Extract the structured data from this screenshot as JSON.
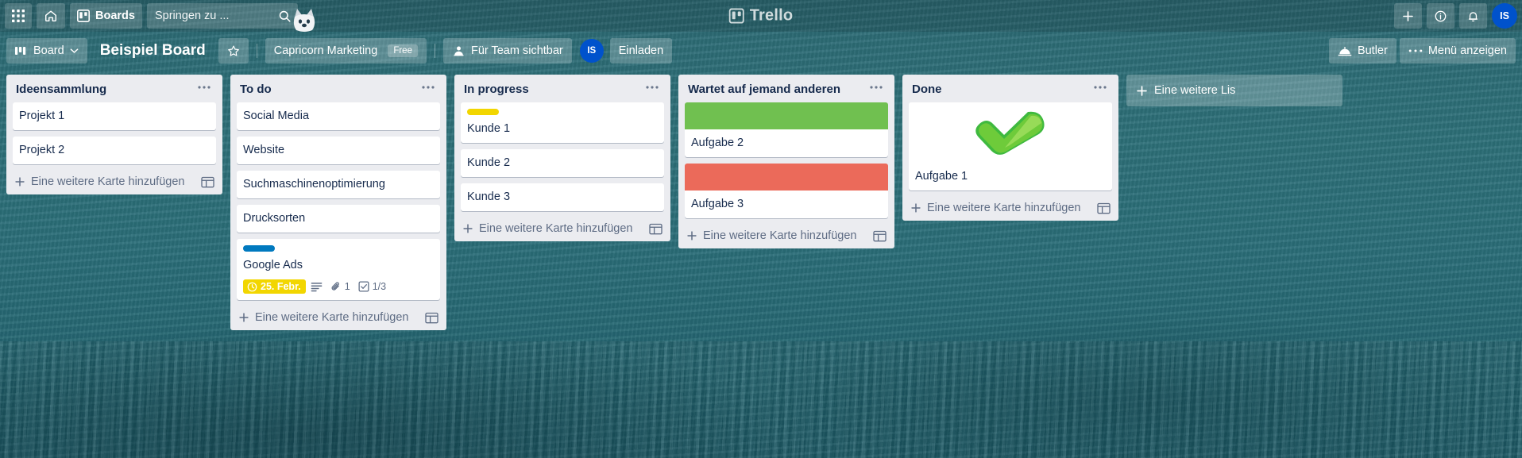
{
  "topbar": {
    "apps_icon": "grid-apps-icon",
    "home_icon": "home-icon",
    "boards_label": "Boards",
    "boards_icon": "board-icon",
    "search_placeholder": "Springen zu ...",
    "search_icon": "search-icon",
    "logo_text": "Trello",
    "logo_icon": "trello-logo-icon",
    "add_icon": "plus-icon",
    "info_icon": "info-icon",
    "notifications_icon": "bell-icon",
    "avatar_initials": "IS",
    "mascot_icon": "taco-dog-icon"
  },
  "boardbar": {
    "view_label": "Board",
    "view_icon": "board-columns-icon",
    "chevron_icon": "chevron-down-icon",
    "board_title": "Beispiel Board",
    "star_icon": "star-icon",
    "team_name": "Capricorn Marketing",
    "plan_badge": "Free",
    "visibility_label": "Für Team sichtbar",
    "visibility_icon": "team-visible-icon",
    "member_initials": "IS",
    "invite_label": "Einladen",
    "butler_label": "Butler",
    "butler_icon": "butler-bell-icon",
    "menu_label": "Menü anzeigen",
    "menu_icon": "dots-icon"
  },
  "board": {
    "add_list_label": "Eine weitere Lis",
    "add_list_icon": "plus-icon",
    "add_card_label": "Eine weitere Karte hinzufügen",
    "add_card_icon": "plus-icon",
    "template_icon": "card-template-icon",
    "list_menu_icon": "ellipsis-icon",
    "lists": [
      {
        "title": "Ideensammlung",
        "cards": [
          {
            "title": "Projekt 1"
          },
          {
            "title": "Projekt 2"
          }
        ]
      },
      {
        "title": "To do",
        "cards": [
          {
            "title": "Social Media"
          },
          {
            "title": "Website"
          },
          {
            "title": "Suchmaschinenoptimierung"
          },
          {
            "title": "Drucksorten"
          },
          {
            "title": "Google Ads",
            "label_color": "#0079bf",
            "badges": {
              "due_icon": "clock-icon",
              "due_date": "25. Febr.",
              "description_icon": "description-icon",
              "attachment_icon": "paperclip-icon",
              "attachment_count": "1",
              "checklist_icon": "checklist-icon",
              "checklist_count": "1/3"
            }
          }
        ]
      },
      {
        "title": "In progress",
        "cards": [
          {
            "title": "Kunde 1",
            "label_color": "#f2d600"
          },
          {
            "title": "Kunde 2"
          },
          {
            "title": "Kunde 3"
          }
        ]
      },
      {
        "title": "Wartet auf jemand anderen",
        "cards": [
          {
            "title": "Aufgabe 2",
            "cover_color": "#70c050"
          },
          {
            "title": "Aufgabe 3",
            "cover_color": "#eb6a5a"
          }
        ]
      },
      {
        "title": "Done",
        "cards": [
          {
            "title": "Aufgabe 1",
            "cover_image": "green-checkmark-image"
          }
        ]
      }
    ]
  },
  "colors": {
    "board_bg": "#2c6b75",
    "list_bg": "#ebecf0",
    "card_bg": "#ffffff",
    "text": "#172b4d",
    "muted": "#5e6c84",
    "accent_blue": "#0052cc",
    "yellow": "#f2d600",
    "green": "#70c050",
    "red": "#eb6a5a",
    "label_blue": "#0079bf"
  }
}
